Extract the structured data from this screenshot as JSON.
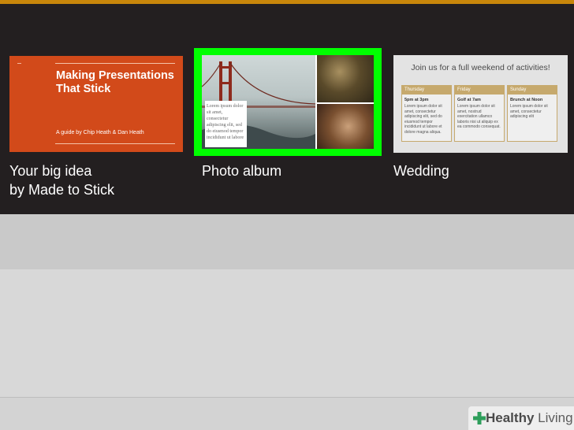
{
  "templates": [
    {
      "title_line1": "Your big idea",
      "title_line2": "by Made to Stick",
      "thumb_heading": "Making Presentations That Stick",
      "thumb_subtitle": "A guide by Chip Heath & Dan Heath"
    },
    {
      "title_line1": "Photo album",
      "thumb_caption": "Lorem ipsum dolor sit amet, consectetur adipiscing elit, sed do eiusmod tempor incididunt ut labore",
      "selected": true
    },
    {
      "title_line1": "Wedding",
      "thumb_heading": "Join us for a full weekend of activities!",
      "days": [
        {
          "day": "Thursday",
          "time": "5pm at 3pm",
          "text": "Lorem ipsum dolor sit amet, consectetur adipiscing elit, sed do eiusmod tempor incididunt ut labore et dolore magna aliqua."
        },
        {
          "day": "Friday",
          "time": "Golf at 7am",
          "text": "Lorem ipsum dolor sit amet, nostrud exercitation ullamco laboris nisi ut aliquip ex ea commodo consequat."
        },
        {
          "day": "Sunday",
          "time": "Brunch at Noon",
          "text": "Lorem ipsum dolor sit amet, consectetur adipiscing elit"
        }
      ]
    }
  ],
  "watermark": {
    "brand_bold": "Healthy",
    "brand_light": " Living"
  },
  "colors": {
    "accent_top": "#c8860a",
    "selection": "#00ff00",
    "card1_bg": "#d24a1a",
    "wedding_gold": "#c6a96d"
  }
}
